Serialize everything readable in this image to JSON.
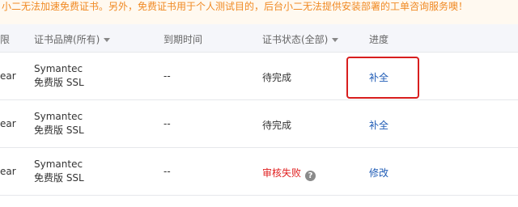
{
  "notice": {
    "text": "小二无法加速免费证书。另外，免费证书用于个人测试目的，后台小二无法提供安装部署的工单咨询服务噢！"
  },
  "table": {
    "headers": {
      "col0": "限",
      "brand": "证书品牌(所有)",
      "expire": "到期时间",
      "status": "证书状态(全部)",
      "progress": "进度"
    },
    "rows": [
      {
        "year": "ear",
        "brand_line1": "Symantec",
        "brand_line2": "免费版 SSL",
        "expire": "--",
        "status": "待完成",
        "progress": "补全"
      },
      {
        "year": "ear",
        "brand_line1": "Symantec",
        "brand_line2": "免费版 SSL",
        "expire": "--",
        "status": "待完成",
        "progress": "补全"
      },
      {
        "year": "ear",
        "brand_line1": "Symantec",
        "brand_line2": "免费版 SSL",
        "expire": "--",
        "status": "审核失败",
        "progress": "修改"
      }
    ]
  },
  "colors": {
    "notice_text": "#f08a24",
    "link": "#1e5bb5",
    "fail": "#e02020",
    "highlight": "#d81e1e"
  },
  "icons": {
    "help": "?"
  }
}
